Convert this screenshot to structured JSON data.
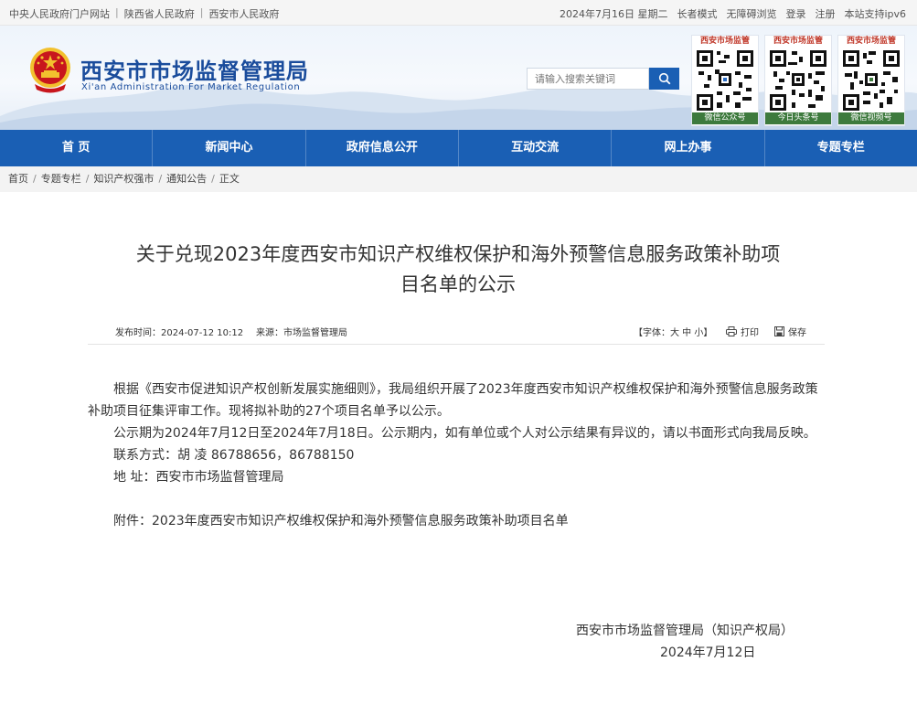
{
  "topbar": {
    "left_links": [
      "中央人民政府门户网站",
      "陕西省人民政府",
      "西安市人民政府"
    ],
    "right_items": [
      "2024年7月16日 星期二",
      "长者模式",
      "无障碍浏览",
      "登录",
      "注册",
      "本站支持ipv6"
    ]
  },
  "header": {
    "brand_cn": "西安市市场监督管理局",
    "brand_en": "Xi'an Administration For Market Regulation",
    "search_placeholder": "请输入搜索关键词",
    "qrcodes": [
      {
        "label": "西安市场监管",
        "caption": "微信公众号"
      },
      {
        "label": "西安市场监管",
        "caption": "今日头条号"
      },
      {
        "label": "西安市场监管",
        "caption": "微信视频号"
      }
    ]
  },
  "nav": [
    "首  页",
    "新闻中心",
    "政府信息公开",
    "互动交流",
    "网上办事",
    "专题专栏"
  ],
  "breadcrumb": [
    "首页",
    "专题专栏",
    "知识产权强市",
    "通知公告",
    "正文"
  ],
  "article": {
    "title_line1": "关于兑现2023年度西安市知识产权维权保护和海外预警信息服务政策补助项",
    "title_line2": "目名单的公示",
    "meta": {
      "publish": "发布时间：2024-07-12 10:12",
      "source": "来源：市场监督管理局",
      "font": "【字体：大 中 小】",
      "print": "打印",
      "save": "保存"
    },
    "paragraphs": [
      "根据《西安市促进知识产权创新发展实施细则》，我局组织开展了2023年度西安市知识产权维权保护和海外预警信息服务政策补助项目征集评审工作。现将拟补助的27个项目名单予以公示。",
      "公示期为2024年7月12日至2024年7月18日。公示期内，如有单位或个人对公示结果有异议的，请以书面形式向我局反映。",
      "联系方式：胡 凌 86788656，86788150",
      "地 址：西安市市场监督管理局"
    ],
    "attachment": "附件：2023年度西安市知识产权维权保护和海外预警信息服务政策补助项目名单",
    "signature": "西安市市场监督管理局（知识产权局）",
    "date": "2024年7月12日"
  },
  "colors": {
    "brand_blue": "#1a5fb4",
    "title_blue": "#1a4c9c",
    "emblem_red": "#c8161d",
    "emblem_gold": "#f2c12e"
  }
}
